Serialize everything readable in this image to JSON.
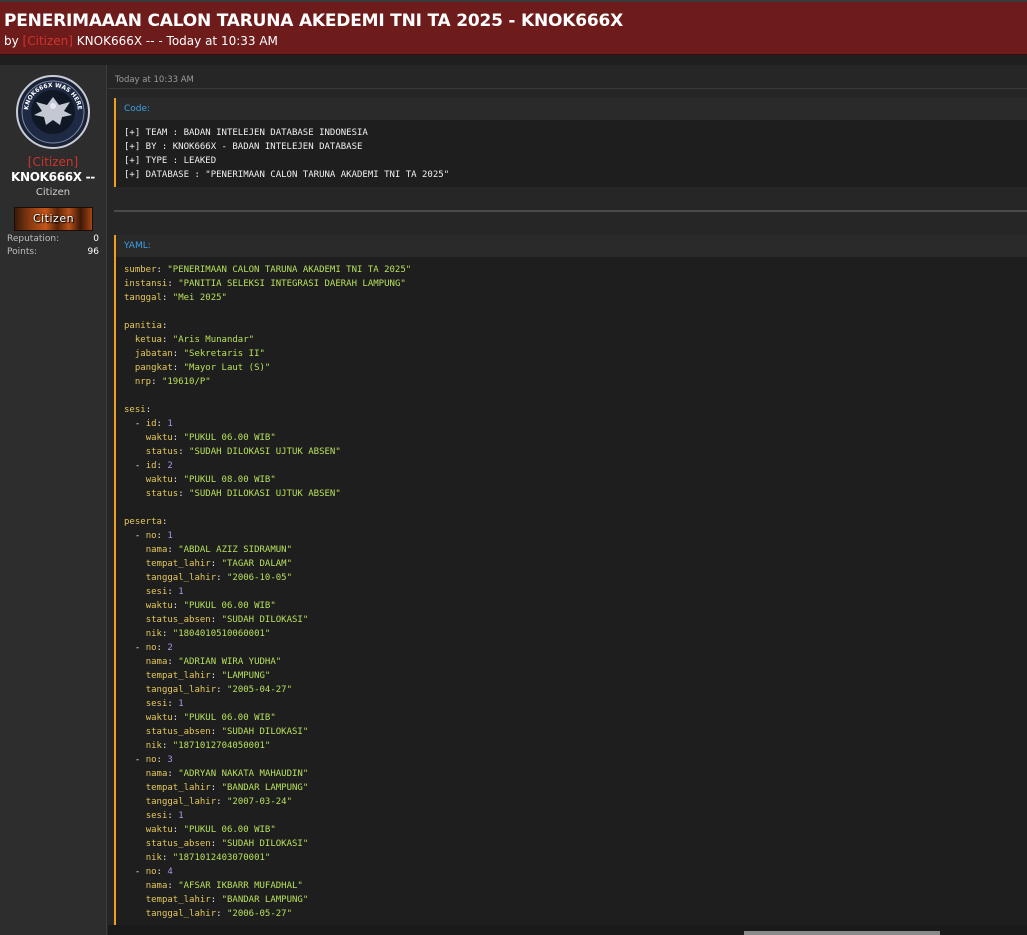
{
  "thread": {
    "title": "PENERIMAAAN CALON TARUNA AKEDEMI TNI TA 2025 - KNOK666X",
    "by_prefix": "by",
    "rank_tag": "[Citizen]",
    "author": "KNOK666X --",
    "separator": "-",
    "time": "Today at 10:33 AM"
  },
  "sidebar": {
    "avatar_text": "KNOK666X WAS HERE",
    "rank_tag": "[Citizen]",
    "username": "KNOK666X --",
    "user_title": "Citizen",
    "userbar_label": "Citizen",
    "stats": [
      {
        "label": "Reputation:",
        "value": "0"
      },
      {
        "label": "Points:",
        "value": "96"
      }
    ]
  },
  "post": {
    "date": "Today at 10:33 AM",
    "code_block": {
      "caption": "Code:",
      "lines": [
        "[+] TEAM : BADAN INTELEJEN DATABASE INDONESIA",
        "[+] BY : KNOK666X - BADAN INTELEJEN DATABASE",
        "[+] TYPE : LEAKED",
        "[+] DATABASE : \"PENERIMAAN CALON TARUNA AKADEMI TNI TA 2025\""
      ]
    },
    "yaml_block": {
      "caption": "YAML:",
      "lines": [
        [
          {
            "t": "k",
            "v": "sumber"
          },
          {
            "t": "p",
            "v": ": "
          },
          {
            "t": "s",
            "v": "\"PENERIMAAN CALON TARUNA AKADEMI TNI TA 2025\""
          }
        ],
        [
          {
            "t": "k",
            "v": "instansi"
          },
          {
            "t": "p",
            "v": ": "
          },
          {
            "t": "s",
            "v": "\"PANITIA SELEKSI INTEGRASI DAERAH LAMPUNG\""
          }
        ],
        [
          {
            "t": "k",
            "v": "tanggal"
          },
          {
            "t": "p",
            "v": ": "
          },
          {
            "t": "s",
            "v": "\"Mei 2025\""
          }
        ],
        [],
        [
          {
            "t": "k",
            "v": "panitia"
          },
          {
            "t": "p",
            "v": ":"
          }
        ],
        [
          {
            "t": "p",
            "v": "  "
          },
          {
            "t": "k",
            "v": "ketua"
          },
          {
            "t": "p",
            "v": ": "
          },
          {
            "t": "s",
            "v": "\"Aris Munandar\""
          }
        ],
        [
          {
            "t": "p",
            "v": "  "
          },
          {
            "t": "k",
            "v": "jabatan"
          },
          {
            "t": "p",
            "v": ": "
          },
          {
            "t": "s",
            "v": "\"Sekretaris II\""
          }
        ],
        [
          {
            "t": "p",
            "v": "  "
          },
          {
            "t": "k",
            "v": "pangkat"
          },
          {
            "t": "p",
            "v": ": "
          },
          {
            "t": "s",
            "v": "\"Mayor Laut (S)\""
          }
        ],
        [
          {
            "t": "p",
            "v": "  "
          },
          {
            "t": "k",
            "v": "nrp"
          },
          {
            "t": "p",
            "v": ": "
          },
          {
            "t": "s",
            "v": "\"19610/P\""
          }
        ],
        [],
        [
          {
            "t": "k",
            "v": "sesi"
          },
          {
            "t": "p",
            "v": ":"
          }
        ],
        [
          {
            "t": "p",
            "v": "  - "
          },
          {
            "t": "k",
            "v": "id"
          },
          {
            "t": "p",
            "v": ": "
          },
          {
            "t": "n",
            "v": "1"
          }
        ],
        [
          {
            "t": "p",
            "v": "    "
          },
          {
            "t": "k",
            "v": "waktu"
          },
          {
            "t": "p",
            "v": ": "
          },
          {
            "t": "s",
            "v": "\"PUKUL 06.00 WIB\""
          }
        ],
        [
          {
            "t": "p",
            "v": "    "
          },
          {
            "t": "k",
            "v": "status"
          },
          {
            "t": "p",
            "v": ": "
          },
          {
            "t": "s",
            "v": "\"SUDAH DILOKASI UJTUK ABSEN\""
          }
        ],
        [
          {
            "t": "p",
            "v": "  - "
          },
          {
            "t": "k",
            "v": "id"
          },
          {
            "t": "p",
            "v": ": "
          },
          {
            "t": "n",
            "v": "2"
          }
        ],
        [
          {
            "t": "p",
            "v": "    "
          },
          {
            "t": "k",
            "v": "waktu"
          },
          {
            "t": "p",
            "v": ": "
          },
          {
            "t": "s",
            "v": "\"PUKUL 08.00 WIB\""
          }
        ],
        [
          {
            "t": "p",
            "v": "    "
          },
          {
            "t": "k",
            "v": "status"
          },
          {
            "t": "p",
            "v": ": "
          },
          {
            "t": "s",
            "v": "\"SUDAH DILOKASI UJTUK ABSEN\""
          }
        ],
        [],
        [
          {
            "t": "k",
            "v": "peserta"
          },
          {
            "t": "p",
            "v": ":"
          }
        ],
        [
          {
            "t": "p",
            "v": "  - "
          },
          {
            "t": "k",
            "v": "no"
          },
          {
            "t": "p",
            "v": ": "
          },
          {
            "t": "n",
            "v": "1"
          }
        ],
        [
          {
            "t": "p",
            "v": "    "
          },
          {
            "t": "k",
            "v": "nama"
          },
          {
            "t": "p",
            "v": ": "
          },
          {
            "t": "s",
            "v": "\"ABDAL AZIZ SIDRAMUN\""
          }
        ],
        [
          {
            "t": "p",
            "v": "    "
          },
          {
            "t": "k",
            "v": "tempat_lahir"
          },
          {
            "t": "p",
            "v": ": "
          },
          {
            "t": "s",
            "v": "\"TAGAR DALAM\""
          }
        ],
        [
          {
            "t": "p",
            "v": "    "
          },
          {
            "t": "k",
            "v": "tanggal_lahir"
          },
          {
            "t": "p",
            "v": ": "
          },
          {
            "t": "s",
            "v": "\"2006-10-05\""
          }
        ],
        [
          {
            "t": "p",
            "v": "    "
          },
          {
            "t": "k",
            "v": "sesi"
          },
          {
            "t": "p",
            "v": ": "
          },
          {
            "t": "n",
            "v": "1"
          }
        ],
        [
          {
            "t": "p",
            "v": "    "
          },
          {
            "t": "k",
            "v": "waktu"
          },
          {
            "t": "p",
            "v": ": "
          },
          {
            "t": "s",
            "v": "\"PUKUL 06.00 WIB\""
          }
        ],
        [
          {
            "t": "p",
            "v": "    "
          },
          {
            "t": "k",
            "v": "status_absen"
          },
          {
            "t": "p",
            "v": ": "
          },
          {
            "t": "s",
            "v": "\"SUDAH DILOKASI\""
          }
        ],
        [
          {
            "t": "p",
            "v": "    "
          },
          {
            "t": "k",
            "v": "nik"
          },
          {
            "t": "p",
            "v": ": "
          },
          {
            "t": "s",
            "v": "\"1804010510060001\""
          }
        ],
        [
          {
            "t": "p",
            "v": "  - "
          },
          {
            "t": "k",
            "v": "no"
          },
          {
            "t": "p",
            "v": ": "
          },
          {
            "t": "n",
            "v": "2"
          }
        ],
        [
          {
            "t": "p",
            "v": "    "
          },
          {
            "t": "k",
            "v": "nama"
          },
          {
            "t": "p",
            "v": ": "
          },
          {
            "t": "s",
            "v": "\"ADRIAN WIRA YUDHA\""
          }
        ],
        [
          {
            "t": "p",
            "v": "    "
          },
          {
            "t": "k",
            "v": "tempat_lahir"
          },
          {
            "t": "p",
            "v": ": "
          },
          {
            "t": "s",
            "v": "\"LAMPUNG\""
          }
        ],
        [
          {
            "t": "p",
            "v": "    "
          },
          {
            "t": "k",
            "v": "tanggal_lahir"
          },
          {
            "t": "p",
            "v": ": "
          },
          {
            "t": "s",
            "v": "\"2005-04-27\""
          }
        ],
        [
          {
            "t": "p",
            "v": "    "
          },
          {
            "t": "k",
            "v": "sesi"
          },
          {
            "t": "p",
            "v": ": "
          },
          {
            "t": "n",
            "v": "1"
          }
        ],
        [
          {
            "t": "p",
            "v": "    "
          },
          {
            "t": "k",
            "v": "waktu"
          },
          {
            "t": "p",
            "v": ": "
          },
          {
            "t": "s",
            "v": "\"PUKUL 06.00 WIB\""
          }
        ],
        [
          {
            "t": "p",
            "v": "    "
          },
          {
            "t": "k",
            "v": "status_absen"
          },
          {
            "t": "p",
            "v": ": "
          },
          {
            "t": "s",
            "v": "\"SUDAH DILOKASI\""
          }
        ],
        [
          {
            "t": "p",
            "v": "    "
          },
          {
            "t": "k",
            "v": "nik"
          },
          {
            "t": "p",
            "v": ": "
          },
          {
            "t": "s",
            "v": "\"1871012704050001\""
          }
        ],
        [
          {
            "t": "p",
            "v": "  - "
          },
          {
            "t": "k",
            "v": "no"
          },
          {
            "t": "p",
            "v": ": "
          },
          {
            "t": "n",
            "v": "3"
          }
        ],
        [
          {
            "t": "p",
            "v": "    "
          },
          {
            "t": "k",
            "v": "nama"
          },
          {
            "t": "p",
            "v": ": "
          },
          {
            "t": "s",
            "v": "\"ADRYAN NAKATA MAHAUDIN\""
          }
        ],
        [
          {
            "t": "p",
            "v": "    "
          },
          {
            "t": "k",
            "v": "tempat_lahir"
          },
          {
            "t": "p",
            "v": ": "
          },
          {
            "t": "s",
            "v": "\"BANDAR LAMPUNG\""
          }
        ],
        [
          {
            "t": "p",
            "v": "    "
          },
          {
            "t": "k",
            "v": "tanggal_lahir"
          },
          {
            "t": "p",
            "v": ": "
          },
          {
            "t": "s",
            "v": "\"2007-03-24\""
          }
        ],
        [
          {
            "t": "p",
            "v": "    "
          },
          {
            "t": "k",
            "v": "sesi"
          },
          {
            "t": "p",
            "v": ": "
          },
          {
            "t": "n",
            "v": "1"
          }
        ],
        [
          {
            "t": "p",
            "v": "    "
          },
          {
            "t": "k",
            "v": "waktu"
          },
          {
            "t": "p",
            "v": ": "
          },
          {
            "t": "s",
            "v": "\"PUKUL 06.00 WIB\""
          }
        ],
        [
          {
            "t": "p",
            "v": "    "
          },
          {
            "t": "k",
            "v": "status_absen"
          },
          {
            "t": "p",
            "v": ": "
          },
          {
            "t": "s",
            "v": "\"SUDAH DILOKASI\""
          }
        ],
        [
          {
            "t": "p",
            "v": "    "
          },
          {
            "t": "k",
            "v": "nik"
          },
          {
            "t": "p",
            "v": ": "
          },
          {
            "t": "s",
            "v": "\"1871012403070001\""
          }
        ],
        [
          {
            "t": "p",
            "v": "  - "
          },
          {
            "t": "k",
            "v": "no"
          },
          {
            "t": "p",
            "v": ": "
          },
          {
            "t": "n",
            "v": "4"
          }
        ],
        [
          {
            "t": "p",
            "v": "    "
          },
          {
            "t": "k",
            "v": "nama"
          },
          {
            "t": "p",
            "v": ": "
          },
          {
            "t": "s",
            "v": "\"AFSAR IKBARR MUFADHAL\""
          }
        ],
        [
          {
            "t": "p",
            "v": "    "
          },
          {
            "t": "k",
            "v": "tempat_lahir"
          },
          {
            "t": "p",
            "v": ": "
          },
          {
            "t": "s",
            "v": "\"BANDAR LAMPUNG\""
          }
        ],
        [
          {
            "t": "p",
            "v": "    "
          },
          {
            "t": "k",
            "v": "tanggal_lahir"
          },
          {
            "t": "p",
            "v": ": "
          },
          {
            "t": "s",
            "v": "\"2006-05-27\""
          }
        ]
      ]
    }
  },
  "colors": {
    "header_bg": "#6e1b1b",
    "rank_red": "#d0342c",
    "code_accent": "#f0a020",
    "caption_blue": "#3aa0e8",
    "yaml_key": "#e4c85a",
    "yaml_string": "#b6e05a",
    "yaml_number": "#b58fe8"
  }
}
